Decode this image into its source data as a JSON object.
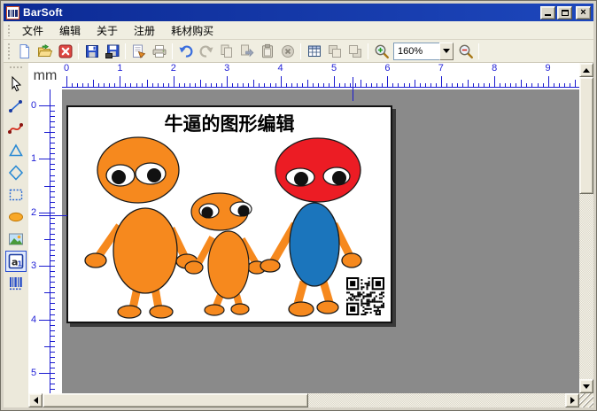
{
  "window": {
    "title": "BarSoft"
  },
  "titlebar": {
    "controls": [
      "minimize",
      "maximize",
      "close"
    ]
  },
  "menu": {
    "items": [
      {
        "label": "文件"
      },
      {
        "label": "编辑"
      },
      {
        "label": "关于"
      },
      {
        "label": "注册"
      },
      {
        "label": "耗材购买"
      }
    ]
  },
  "toolbar": {
    "zoom_value": "160%",
    "icons": [
      "new-document",
      "open-file",
      "close-file",
      "save-file",
      "save-as",
      "page-setup",
      "print",
      "undo",
      "redo",
      "copy",
      "move",
      "paste",
      "delete",
      "grid-settings",
      "bring-to-front",
      "send-to-back",
      "zoom-in",
      "zoom-out"
    ]
  },
  "tools": {
    "items": [
      "select",
      "line",
      "curve",
      "triangle",
      "diamond",
      "rectangle",
      "ellipse",
      "image",
      "text",
      "barcode"
    ],
    "active": "text"
  },
  "rulers": {
    "unit": "mm",
    "horizontal_numbers": [
      "0",
      "1",
      "2",
      "3",
      "4",
      "5",
      "6",
      "7",
      "8",
      "9"
    ],
    "vertical_numbers": [
      "0",
      "1",
      "2",
      "3",
      "4",
      "5"
    ],
    "tick_color": "#1a1ad0"
  },
  "canvas": {
    "label_title": "牛逼的图形编辑",
    "colors": {
      "figure_orange": "#f6891e",
      "figure_red": "#ec1c24",
      "figure_blue": "#1b75bc",
      "canvas_gray": "#8a8a8a"
    },
    "objects": [
      "figure-left-orange",
      "figure-middle-orange",
      "figure-right-red-blue",
      "qr-code",
      "title-text"
    ]
  }
}
